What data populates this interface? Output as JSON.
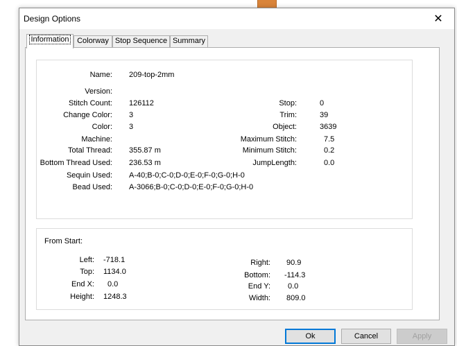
{
  "window": {
    "title": "Design Options",
    "close_glyph": "✕"
  },
  "tabs": [
    {
      "label": "Information"
    },
    {
      "label": "Colorway"
    },
    {
      "label": "Stop Sequence"
    },
    {
      "label": "Summary"
    }
  ],
  "info": {
    "name": {
      "label": "Name:",
      "value": "209-top-2mm"
    },
    "version": {
      "label": "Version:",
      "value": ""
    },
    "stitch_count": {
      "label": "Stitch Count:",
      "value": "126112"
    },
    "change_color": {
      "label": "Change Color:",
      "value": "3"
    },
    "color": {
      "label": "Color:",
      "value": "3"
    },
    "machine": {
      "label": "Machine:",
      "value": ""
    },
    "total_thread": {
      "label": "Total Thread:",
      "value": "355.87 m"
    },
    "bottom_thread": {
      "label": "Bottom Thread Used:",
      "value": "236.53 m"
    },
    "sequin_used": {
      "label": "Sequin Used:",
      "value": "A-40;B-0;C-0;D-0;E-0;F-0;G-0;H-0"
    },
    "bead_used": {
      "label": "Bead Used:",
      "value": "A-3066;B-0;C-0;D-0;E-0;F-0;G-0;H-0"
    },
    "stop": {
      "label": "Stop:",
      "value": "0"
    },
    "trim": {
      "label": "Trim:",
      "value": "39"
    },
    "object": {
      "label": "Object:",
      "value": "3639"
    },
    "max_stitch": {
      "label": "Maximum Stitch:",
      "value": "7.5"
    },
    "min_stitch": {
      "label": "Minimum Stitch:",
      "value": "0.2"
    },
    "jump_length": {
      "label": "JumpLength:",
      "value": "0.0"
    }
  },
  "from_start": {
    "heading": "From Start:",
    "left": {
      "label": "Left:",
      "value": "-718.1"
    },
    "top": {
      "label": "Top:",
      "value": "1134.0"
    },
    "end_x": {
      "label": "End X:",
      "value": "0.0"
    },
    "height": {
      "label": "Height:",
      "value": "1248.3"
    },
    "right": {
      "label": "Right:",
      "value": "90.9"
    },
    "bottom": {
      "label": "Bottom:",
      "value": "-114.3"
    },
    "end_y": {
      "label": "End Y:",
      "value": "0.0"
    },
    "width": {
      "label": "Width:",
      "value": "809.0"
    }
  },
  "buttons": {
    "ok": "Ok",
    "cancel": "Cancel",
    "apply": "Apply"
  },
  "colors": {
    "accent": "#0078d7",
    "dialog_bg": "#f0f0f0"
  }
}
